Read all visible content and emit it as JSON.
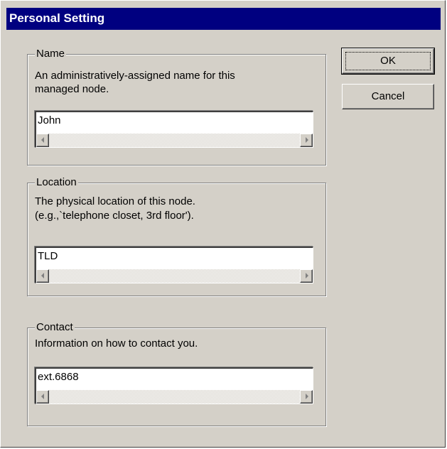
{
  "window": {
    "title": "Personal Setting"
  },
  "buttons": {
    "ok_label": "OK",
    "cancel_label": "Cancel"
  },
  "groups": {
    "name": {
      "legend": "Name",
      "description": [
        "An administratively-assigned name for this",
        "managed node."
      ],
      "value": "John"
    },
    "location": {
      "legend": "Location",
      "description": [
        "The physical location of this node.",
        "(e.g.,`telephone closet, 3rd floor')."
      ],
      "value": "TLD"
    },
    "contact": {
      "legend": "Contact",
      "description": [
        "Information on how to contact you."
      ],
      "value": "ext.6868"
    }
  },
  "colors": {
    "titlebar": "#000080",
    "dialog_face": "#d4d0c8"
  },
  "icons": {
    "scroll_left": "scroll-left-arrow-icon",
    "scroll_right": "scroll-right-arrow-icon"
  }
}
